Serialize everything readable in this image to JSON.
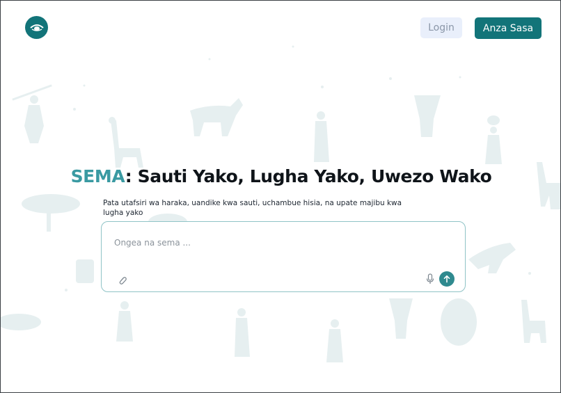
{
  "header": {
    "logo_icon": "eye-logo-icon",
    "login_label": "Login",
    "start_label": "Anza Sasa"
  },
  "hero": {
    "title_accent": "SEMA",
    "title_rest": ": Sauti Yako, Lugha Yako, Uwezo Wako",
    "subtitle": "Pata utafsiri wa haraka, uandike kwa sauti, uchambue hisia, na upate majibu kwa lugha yako"
  },
  "composer": {
    "placeholder": "Ongea na sema ...",
    "value": "",
    "icons": [
      "paperclip-icon",
      "microphone-icon",
      "arrow-up-icon"
    ]
  },
  "colors": {
    "brand": "#127479",
    "accent_text": "#3a9aa2",
    "background_art": "#e8f1f2"
  }
}
